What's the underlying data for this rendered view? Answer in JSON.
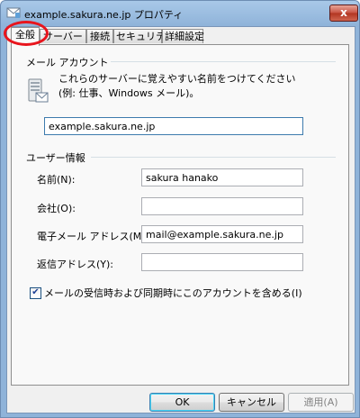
{
  "window": {
    "title": "example.sakura.ne.jp プロパティ",
    "close_glyph": "x"
  },
  "tabs": [
    {
      "label": "全般",
      "active": true
    },
    {
      "label": "サーバー",
      "active": false
    },
    {
      "label": "接続",
      "active": false
    },
    {
      "label": "セキュリティ",
      "active": false
    },
    {
      "label": "詳細設定",
      "active": false
    }
  ],
  "mail_account": {
    "header": "メール アカウント",
    "description_line1": "これらのサーバーに覚えやすい名前をつけてください",
    "description_line2": "(例: 仕事、Windows メール)。",
    "account_name_value": "example.sakura.ne.jp"
  },
  "user_info": {
    "header": "ユーザー情報",
    "name_label": "名前(N):",
    "name_value": "sakura hanako",
    "company_label": "会社(O):",
    "company_value": "",
    "email_label": "電子メール アドレス(M):",
    "email_value": "mail@example.sakura.ne.jp",
    "reply_label": "返信アドレス(Y):",
    "reply_value": ""
  },
  "include_checkbox": {
    "label": "メールの受信時および同期時にこのアカウントを含める(I)",
    "checked": true,
    "glyph": "✔"
  },
  "buttons": {
    "ok": "OK",
    "cancel": "キャンセル",
    "apply": "適用(A)"
  },
  "colors": {
    "highlight_ring": "#e8141c"
  }
}
